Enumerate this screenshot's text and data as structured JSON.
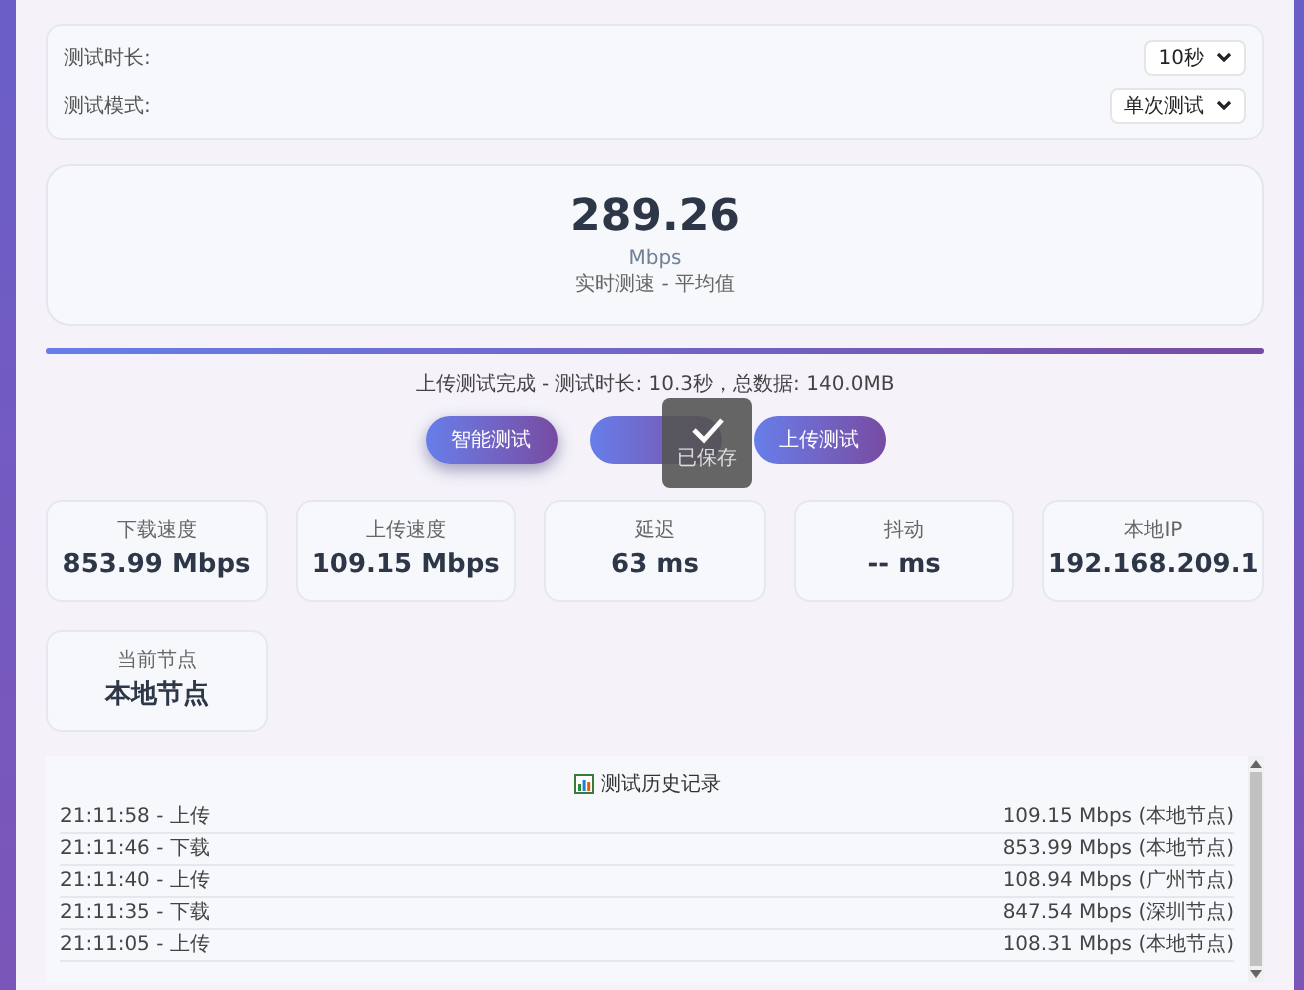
{
  "settings": [
    {
      "label": "测试时长:",
      "value": "10秒"
    },
    {
      "label": "测试模式:",
      "value": "单次测试"
    }
  ],
  "speed": {
    "value": "289.26",
    "unit": "Mbps",
    "caption": "实时测速 - 平均值"
  },
  "progress": {
    "level": 1
  },
  "status": "上传测试完成 - 测试时长: 10.3秒，总数据: 140.0MB",
  "buttons": [
    {
      "label": "智能测试",
      "selected": true
    },
    {
      "selected": false
    },
    {
      "label": "上传测试",
      "selected": false
    }
  ],
  "toast": {
    "text": "已保存"
  },
  "stats": [
    {
      "label": "下载速度",
      "value": "853.99 Mbps"
    },
    {
      "label": "上传速度",
      "value": "109.15 Mbps"
    },
    {
      "label": "延迟",
      "value": "63 ms"
    },
    {
      "label": "抖动",
      "value": "-- ms"
    },
    {
      "label": "本地IP",
      "value": "192.168.209.1"
    },
    {
      "label": "当前节点",
      "value": "本地节点"
    }
  ],
  "history": {
    "title": "测试历史记录",
    "rows": [
      {
        "time": "21:11:58 - 上传",
        "result": "109.15 Mbps (本地节点)"
      },
      {
        "time": "21:11:46 - 下载",
        "result": "853.99 Mbps (本地节点)"
      },
      {
        "time": "21:11:40 - 上传",
        "result": "108.94 Mbps (广州节点)"
      },
      {
        "time": "21:11:35 - 下载",
        "result": "847.54 Mbps (深圳节点)"
      },
      {
        "time": "21:11:05 - 上传",
        "result": "108.31 Mbps (本地节点)"
      }
    ]
  }
}
